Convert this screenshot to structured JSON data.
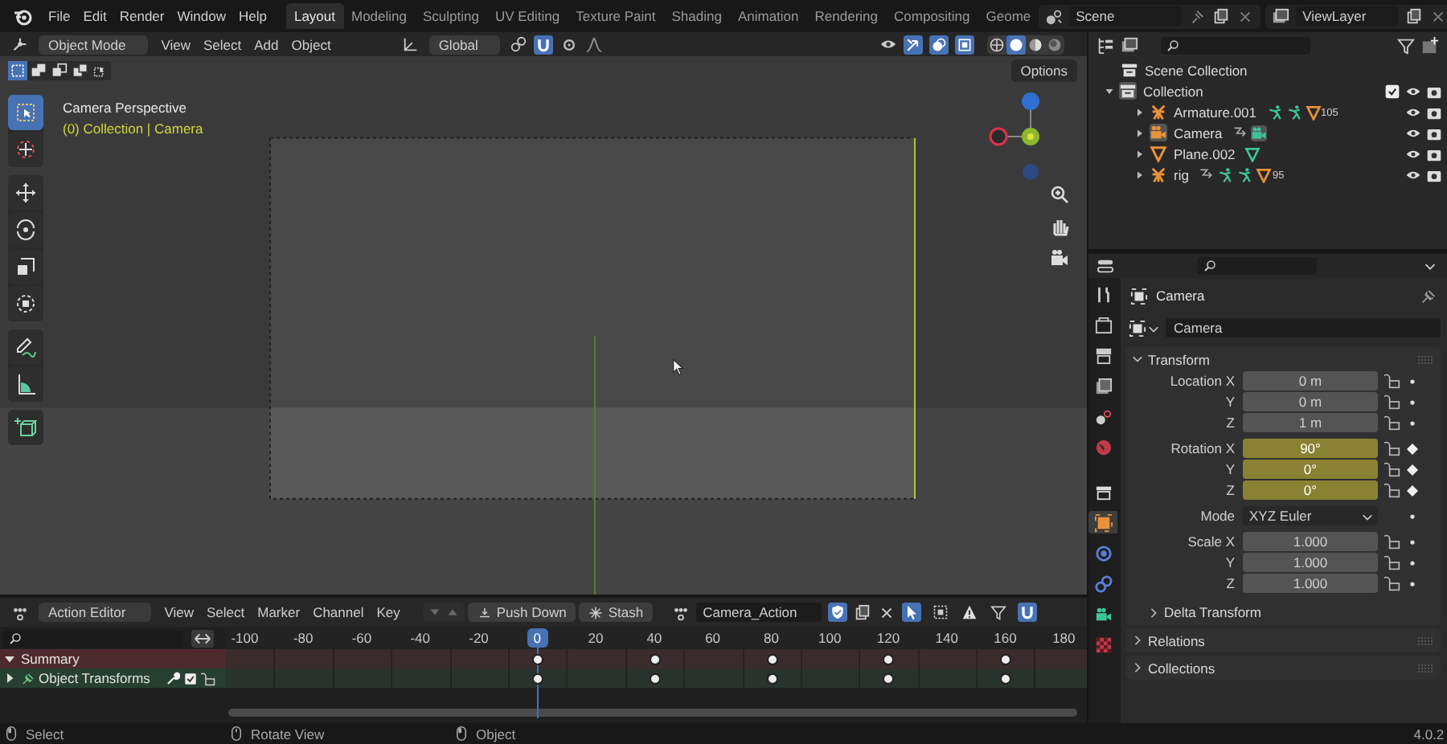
{
  "top_bar": {
    "menus": [
      "File",
      "Edit",
      "Render",
      "Window",
      "Help"
    ],
    "workspaces": [
      {
        "label": "Layout",
        "selected": true
      },
      {
        "label": "Modeling",
        "selected": false
      },
      {
        "label": "Sculpting",
        "selected": false
      },
      {
        "label": "UV Editing",
        "selected": false
      },
      {
        "label": "Texture Paint",
        "selected": false
      },
      {
        "label": "Shading",
        "selected": false
      },
      {
        "label": "Animation",
        "selected": false
      },
      {
        "label": "Rendering",
        "selected": false
      },
      {
        "label": "Compositing",
        "selected": false
      },
      {
        "label": "Geome",
        "selected": false
      }
    ],
    "scene": "Scene",
    "view_layer": "ViewLayer"
  },
  "viewport": {
    "mode": "Object Mode",
    "menus": [
      "View",
      "Select",
      "Add",
      "Object"
    ],
    "orientation": "Global",
    "toggles": [
      {
        "kind": "snap",
        "on": true
      },
      {
        "kind": "proportional",
        "on": false
      }
    ],
    "right_toggles": [
      {
        "kind": "gizmo",
        "on": true
      },
      {
        "kind": "overlay",
        "on": true
      },
      {
        "kind": "xray",
        "on": true
      }
    ],
    "shading": [
      {
        "kind": "wireframe",
        "selected": false
      },
      {
        "kind": "solid",
        "selected": true
      },
      {
        "kind": "material",
        "selected": false
      },
      {
        "kind": "rendered",
        "selected": false
      }
    ],
    "select_modes": [
      {
        "kind": "set",
        "selected": true
      },
      {
        "kind": "extend",
        "selected": false
      },
      {
        "kind": "subtract",
        "selected": false
      },
      {
        "kind": "invert",
        "selected": false
      },
      {
        "kind": "intersect",
        "selected": false
      }
    ],
    "options": "Options",
    "tool_groups": [
      [
        {
          "kind": "select",
          "selected": true
        },
        {
          "kind": "cursor",
          "selected": false
        }
      ],
      [
        {
          "kind": "move",
          "selected": false
        },
        {
          "kind": "rotate",
          "selected": false
        },
        {
          "kind": "scale",
          "selected": false
        },
        {
          "kind": "transform",
          "selected": false
        }
      ],
      [
        {
          "kind": "annotate",
          "selected": false
        },
        {
          "kind": "measure",
          "selected": false
        }
      ],
      [
        {
          "kind": "add_cube",
          "selected": false
        }
      ]
    ],
    "view_title": "Camera Perspective",
    "context": "(0) Collection | Camera"
  },
  "outliner": {
    "root": "Scene Collection",
    "collections": [
      {
        "label": "Collection",
        "expanded": true,
        "checked": true,
        "children": [
          {
            "label": "Armature.001",
            "kind": "armature",
            "expanded": false,
            "extras": [
              {
                "kind": "pose"
              },
              {
                "kind": "pose"
              },
              {
                "kind": "vertex_groups",
                "count": "105"
              }
            ]
          },
          {
            "label": "Camera",
            "kind": "camera",
            "expanded": false,
            "extras": [
              {
                "kind": "link"
              },
              {
                "kind": "camera_data"
              }
            ]
          },
          {
            "label": "Plane.002",
            "kind": "mesh",
            "expanded": false,
            "extras": [
              {
                "kind": "mesh_data"
              }
            ]
          },
          {
            "label": "rig",
            "kind": "armature",
            "expanded": false,
            "extras": [
              {
                "kind": "link"
              },
              {
                "kind": "pose"
              },
              {
                "kind": "pose"
              },
              {
                "kind": "vertex_groups",
                "count": "95"
              }
            ]
          }
        ]
      }
    ]
  },
  "properties": {
    "tabs": [
      {
        "kind": "tool",
        "selected": false
      },
      {
        "kind": "render",
        "selected": false
      },
      {
        "kind": "output",
        "selected": false
      },
      {
        "kind": "view_layer",
        "selected": false
      },
      {
        "kind": "scene",
        "selected": false
      },
      {
        "kind": "world",
        "selected": false
      },
      {
        "kind": "collection",
        "selected": false
      },
      {
        "kind": "object",
        "selected": true
      },
      {
        "kind": "physics",
        "selected": false
      },
      {
        "kind": "constraints",
        "selected": false
      },
      {
        "kind": "data",
        "selected": false
      },
      {
        "kind": "texture",
        "selected": false
      }
    ],
    "object": "Camera",
    "data": "Camera",
    "transform": {
      "label": "Transform",
      "expanded": true,
      "groups": [
        {
          "rows": [
            {
              "label": "Location X",
              "value": "0 m",
              "kind": "number",
              "keyed": false
            },
            {
              "label": "Y",
              "value": "0 m",
              "kind": "number",
              "keyed": false
            },
            {
              "label": "Z",
              "value": "1 m",
              "kind": "number",
              "keyed": false
            }
          ]
        },
        {
          "rows": [
            {
              "label": "Rotation X",
              "value": "90°",
              "kind": "number",
              "keyed": true
            },
            {
              "label": "Y",
              "value": "0°",
              "kind": "number",
              "keyed": true
            },
            {
              "label": "Z",
              "value": "0°",
              "kind": "number",
              "keyed": true
            }
          ]
        },
        {
          "rows": [
            {
              "label": "Mode",
              "value": "XYZ Euler",
              "kind": "dropdown",
              "keyed": false
            }
          ]
        },
        {
          "rows": [
            {
              "label": "Scale X",
              "value": "1.000",
              "kind": "number",
              "keyed": false
            },
            {
              "label": "Y",
              "value": "1.000",
              "kind": "number",
              "keyed": false
            },
            {
              "label": "Z",
              "value": "1.000",
              "kind": "number",
              "keyed": false
            }
          ]
        }
      ],
      "subpanels": [
        {
          "label": "Delta Transform",
          "expanded": false
        }
      ]
    },
    "panels": [
      {
        "label": "Relations",
        "expanded": false
      },
      {
        "label": "Collections",
        "expanded": false
      }
    ]
  },
  "action_editor": {
    "editor": "Action Editor",
    "menus": [
      "View",
      "Select",
      "Marker",
      "Channel",
      "Key"
    ],
    "push_down": "Push Down",
    "stash": "Stash",
    "action": "Camera_Action",
    "fake_user": true,
    "header_toggles": [
      {
        "kind": "pointer",
        "on": true
      },
      {
        "kind": "box",
        "on": false
      },
      {
        "kind": "warning",
        "on": false
      },
      {
        "kind": "filter",
        "on": false
      },
      {
        "kind": "snap",
        "on": true
      }
    ],
    "ruler": [
      {
        "label": "-100",
        "keyed": false,
        "current": false
      },
      {
        "label": "-80",
        "keyed": false,
        "current": false
      },
      {
        "label": "-60",
        "keyed": false,
        "current": false
      },
      {
        "label": "-40",
        "keyed": false,
        "current": false
      },
      {
        "label": "-20",
        "keyed": false,
        "current": false
      },
      {
        "label": "0",
        "keyed": true,
        "current": true
      },
      {
        "label": "20",
        "keyed": false,
        "current": false
      },
      {
        "label": "40",
        "keyed": true,
        "current": false
      },
      {
        "label": "60",
        "keyed": false,
        "current": false
      },
      {
        "label": "80",
        "keyed": true,
        "current": false
      },
      {
        "label": "100",
        "keyed": false,
        "current": false
      },
      {
        "label": "120",
        "keyed": true,
        "current": false
      },
      {
        "label": "140",
        "keyed": false,
        "current": false
      },
      {
        "label": "160",
        "keyed": true,
        "current": false
      },
      {
        "label": "180",
        "keyed": false,
        "current": false
      }
    ],
    "channels": [
      {
        "label": "Summary",
        "kind": "summary",
        "expanded": true
      },
      {
        "label": "Object Transforms",
        "kind": "group",
        "expanded": false
      }
    ]
  },
  "status_bar": {
    "hints": [
      "Select",
      "Rotate View",
      "Object"
    ],
    "version": "4.0.2"
  }
}
